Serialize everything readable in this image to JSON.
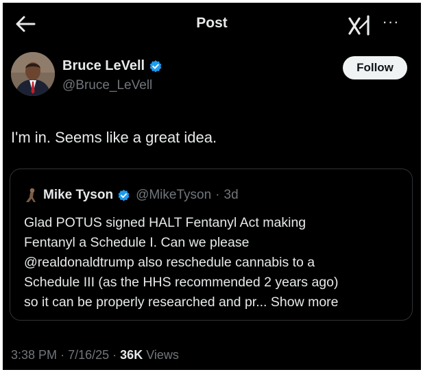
{
  "header": {
    "title": "Post",
    "back_icon": "arrow-left-icon",
    "grok_icon": "grok-icon",
    "more_label": "···"
  },
  "author": {
    "name": "Bruce LeVell",
    "handle": "@Bruce_LeVell",
    "follow_label": "Follow",
    "verified_color": "#1d9bf0"
  },
  "post": {
    "text": "I'm in. Seems like a great idea."
  },
  "quote": {
    "name": "Mike Tyson",
    "handle": "@MikeTyson",
    "separator": "·",
    "age": "3d",
    "lines": [
      "Glad POTUS signed HALT Fentanyl Act making",
      "Fentanyl a Schedule I.  Can we please",
      "@realdonaldtrump also reschedule cannabis to a",
      "Schedule III (as the HHS recommended 2 years ago)",
      "so it can be properly researched and pr..."
    ],
    "show_more": "Show more"
  },
  "meta": {
    "time": "3:38 PM",
    "dot": "·",
    "date": "7/16/25",
    "views_count": "36K",
    "views_label": "Views"
  },
  "colors": {
    "background": "#000000",
    "text": "#e7e9ea",
    "secondary": "#71767b",
    "border": "#2f3336"
  }
}
